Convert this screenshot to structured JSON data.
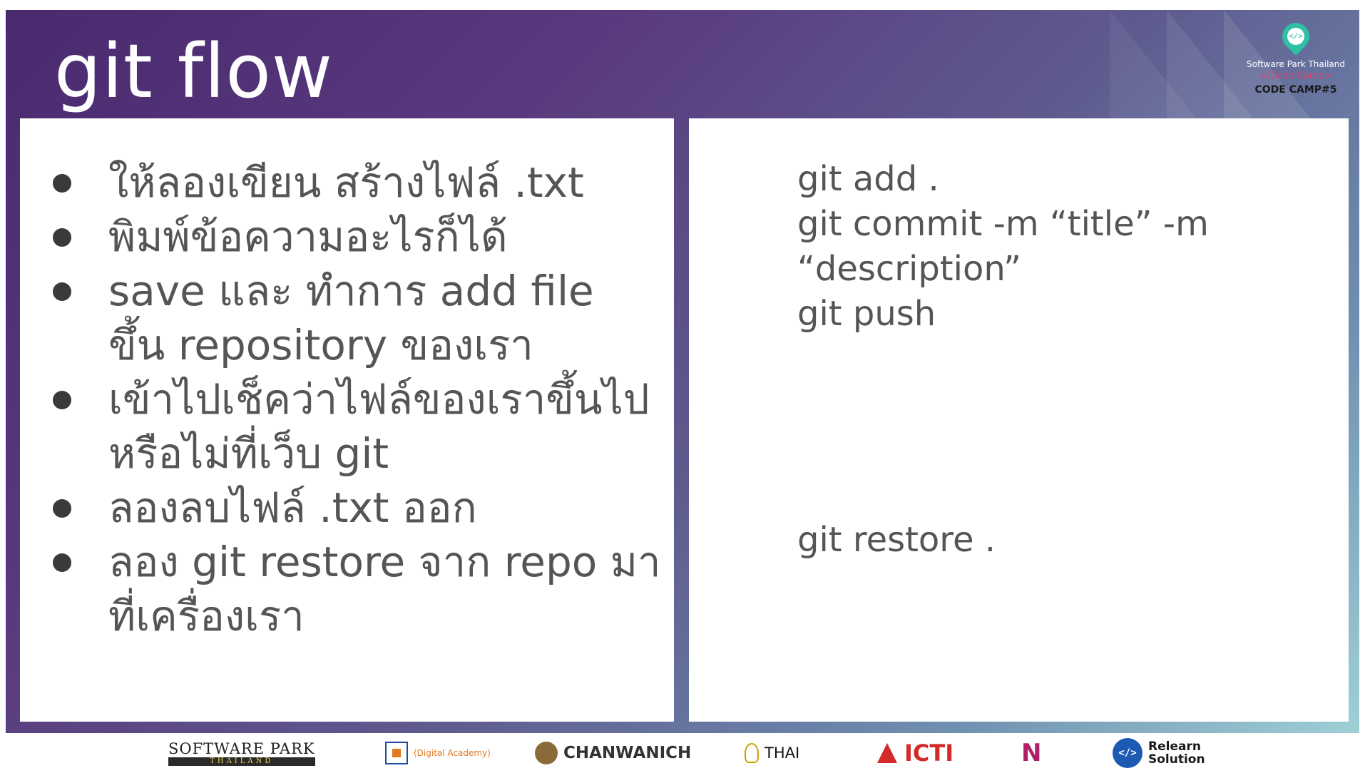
{
  "slide": {
    "title": "git flow",
    "logo": {
      "icon": "code-pin-icon",
      "icon_glyph": "</>",
      "line1": "Software Park Thailand",
      "line2": "</Code Camp>",
      "line3": "CODE CAMP#5"
    },
    "left_panel": {
      "bullets": [
        "ให้ลองเขียน สร้างไฟล์ .txt",
        "พิมพ์ข้อความอะไรก็ได้",
        "save และ ทำการ add file ขึ้น repository ของเรา",
        "เข้าไปเช็คว่าไฟล์ของเราขึ้นไป หรือไม่ที่เว็บ git",
        "ลองลบไฟล์ .txt ออก",
        "ลอง git restore จาก repo มาที่เครื่องเรา"
      ]
    },
    "right_panel": {
      "commands_top": [
        "git add .",
        "git commit -m “title” -m “description”",
        "git push"
      ],
      "command_bottom": "git restore ."
    },
    "colors": {
      "gradient_start": "#4a2a6e",
      "gradient_end": "#9fd0d6",
      "text": "#555555",
      "accent": "#2fbfa5"
    }
  },
  "sponsors": {
    "software_park": {
      "name": "SOFTWARE PARK",
      "sub": "THAILAND"
    },
    "digital_academy": {
      "name": "(Digital Academy)"
    },
    "chanwanich": {
      "name": "CHANWANICH"
    },
    "thai_programmer": {
      "name": "THAI"
    },
    "icti": {
      "name": "ICTI"
    },
    "nipa": {
      "name": "N"
    },
    "relearn": {
      "line1": "Relearn",
      "line2": "Solution",
      "glyph": "</>"
    }
  }
}
